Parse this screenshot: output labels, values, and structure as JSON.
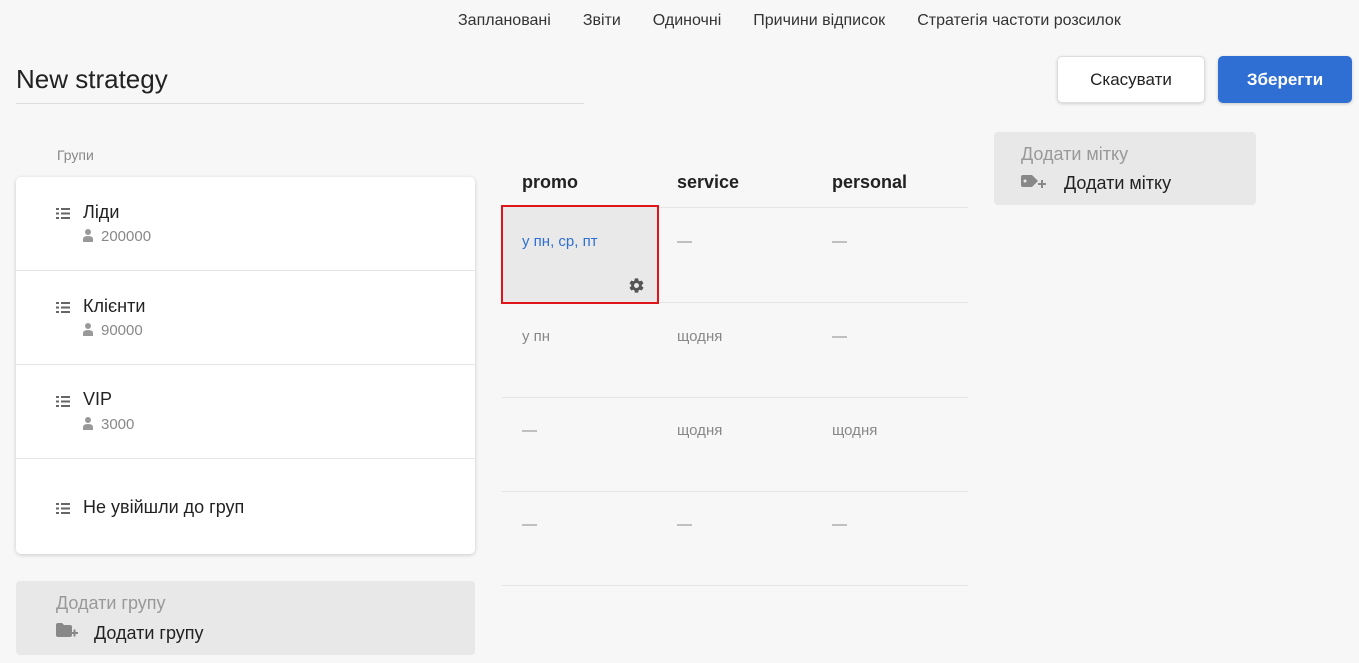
{
  "nav": {
    "items": [
      "Заплановані",
      "Звіти",
      "Одиночні",
      "Причини відписок",
      "Стратегія частоти розсилок"
    ]
  },
  "header": {
    "title": "New strategy",
    "cancel_label": "Скасувати",
    "save_label": "Зберегти"
  },
  "groups": {
    "section_label": "Групи",
    "items": [
      {
        "name": "Ліди",
        "count": "200000"
      },
      {
        "name": "Клієнти",
        "count": "90000"
      },
      {
        "name": "VIP",
        "count": "3000"
      },
      {
        "name": "Не увійшли до груп"
      }
    ],
    "add_placeholder": "Додати групу",
    "add_label": "Додати групу"
  },
  "matrix": {
    "columns": [
      "promo",
      "service",
      "personal"
    ],
    "rows": [
      [
        "у пн, ср, пт",
        "—",
        "—"
      ],
      [
        "у пн",
        "щодня",
        "—"
      ],
      [
        "—",
        "щодня",
        "щодня"
      ],
      [
        "—",
        "—",
        "—"
      ]
    ]
  },
  "tags": {
    "add_placeholder": "Додати мітку",
    "add_label": "Додати мітку"
  },
  "colors": {
    "accent": "#2f6fd4",
    "highlight_border": "#e0151b"
  }
}
